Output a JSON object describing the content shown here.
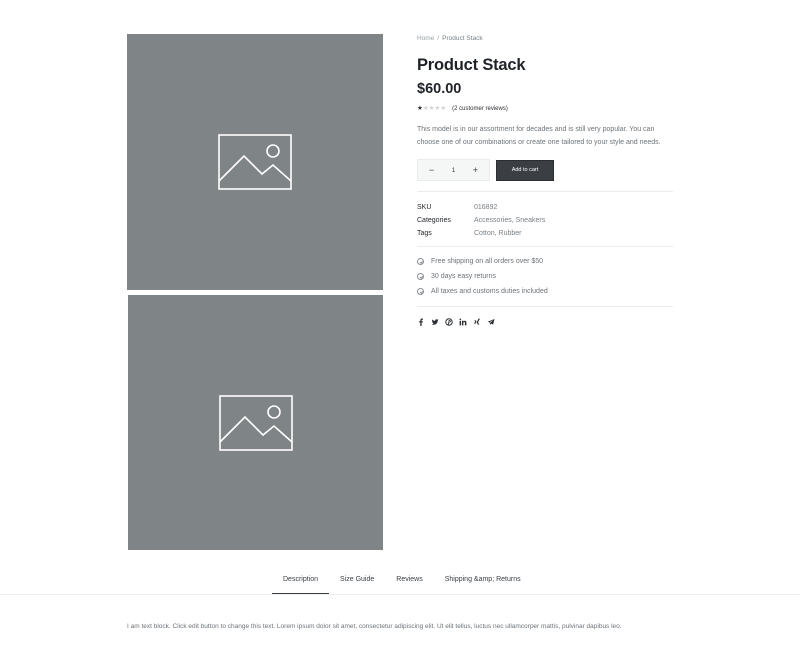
{
  "gallery": {
    "images": [
      {
        "alt_icon": "image-placeholder-icon"
      },
      {
        "alt_icon": "image-placeholder-icon"
      }
    ],
    "placeholder_color": "#7f8487"
  },
  "breadcrumb": {
    "home": "Home",
    "separator": "/",
    "current": "Product Stack"
  },
  "product": {
    "title": "Product Stack",
    "price": "$60.00",
    "rating": 1,
    "rating_max": 5,
    "reviews_label": "(2 customer reviews)",
    "description": "This model is in our assortment for decades and is still very popular. You can choose one of our combinations or create one tailored to your style and needs."
  },
  "cart": {
    "minus": "−",
    "quantity": "1",
    "plus": "+",
    "add_label": "Add to cart",
    "button_color": "#3b3f44"
  },
  "meta": {
    "sku_label": "SKU",
    "sku_value": "016892",
    "categories_label": "Categories",
    "categories_value": "Accessories, Sneakers",
    "tags_label": "Tags",
    "tags_value": "Cotton, Rubber"
  },
  "features": [
    {
      "icon": "check-circle-icon",
      "text": "Free shipping on all orders over $50"
    },
    {
      "icon": "check-circle-icon",
      "text": "30 days easy returns"
    },
    {
      "icon": "check-circle-icon",
      "text": "All taxes and customs duties included"
    }
  ],
  "social": [
    "facebook-icon",
    "twitter-icon",
    "pinterest-icon",
    "linkedin-icon",
    "xing-icon",
    "telegram-icon"
  ],
  "tabs": [
    {
      "label": "Description",
      "active": true
    },
    {
      "label": "Size Guide",
      "active": false
    },
    {
      "label": "Reviews",
      "active": false
    },
    {
      "label": "Shipping &amp; Returns",
      "active": false
    }
  ],
  "tab_content": "I am text block. Click edit button to change this text. Lorem ipsum dolor sit amet, consectetur adipiscing elit. Ut elit tellus, luctus nec ullamcorper mattis, pulvinar dapibus leo."
}
